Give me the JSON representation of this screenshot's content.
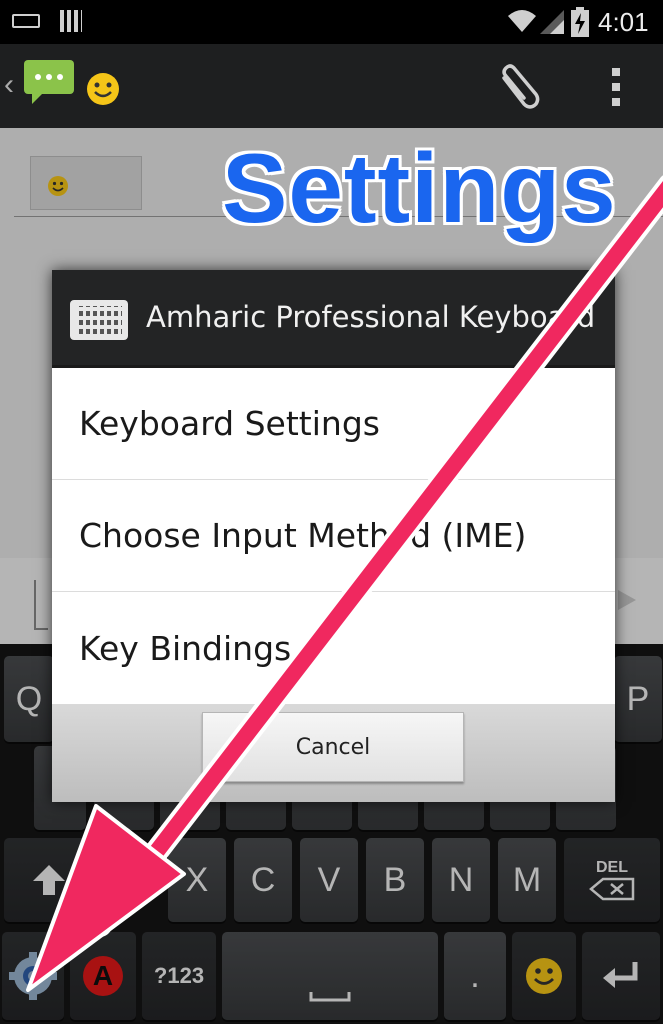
{
  "status_bar": {
    "time": "4:01",
    "icons": [
      "keyboard-icon",
      "barcode-icon",
      "wifi-icon",
      "signal-icon",
      "battery-charging-icon"
    ]
  },
  "action_bar": {
    "back_glyph": "‹",
    "icons": [
      "messaging-app-icon",
      "smiley-icon",
      "attach-icon",
      "overflow-menu-icon"
    ]
  },
  "dialog": {
    "title": "Amharic Professional Keyboard",
    "items": [
      {
        "label": "Keyboard Settings"
      },
      {
        "label": "Choose Input Method (IME)"
      },
      {
        "label": "Key Bindings"
      }
    ],
    "cancel_label": "Cancel"
  },
  "keyboard": {
    "row1_visible": {
      "left": "Q",
      "right": "P"
    },
    "row3": [
      "X",
      "C",
      "V",
      "B",
      "N",
      "M"
    ],
    "del_label": "DEL",
    "symbols_label": "?123",
    "period_label": ".",
    "lang_label": "A"
  },
  "annotation": {
    "text": "Settings",
    "color": "#1a66ef",
    "arrow_color": "#f0285f"
  },
  "colors": {
    "status_bar": "#000000",
    "action_bar": "#1e1f20",
    "dialog_header": "#232425",
    "keyboard_bg": "#151515"
  }
}
